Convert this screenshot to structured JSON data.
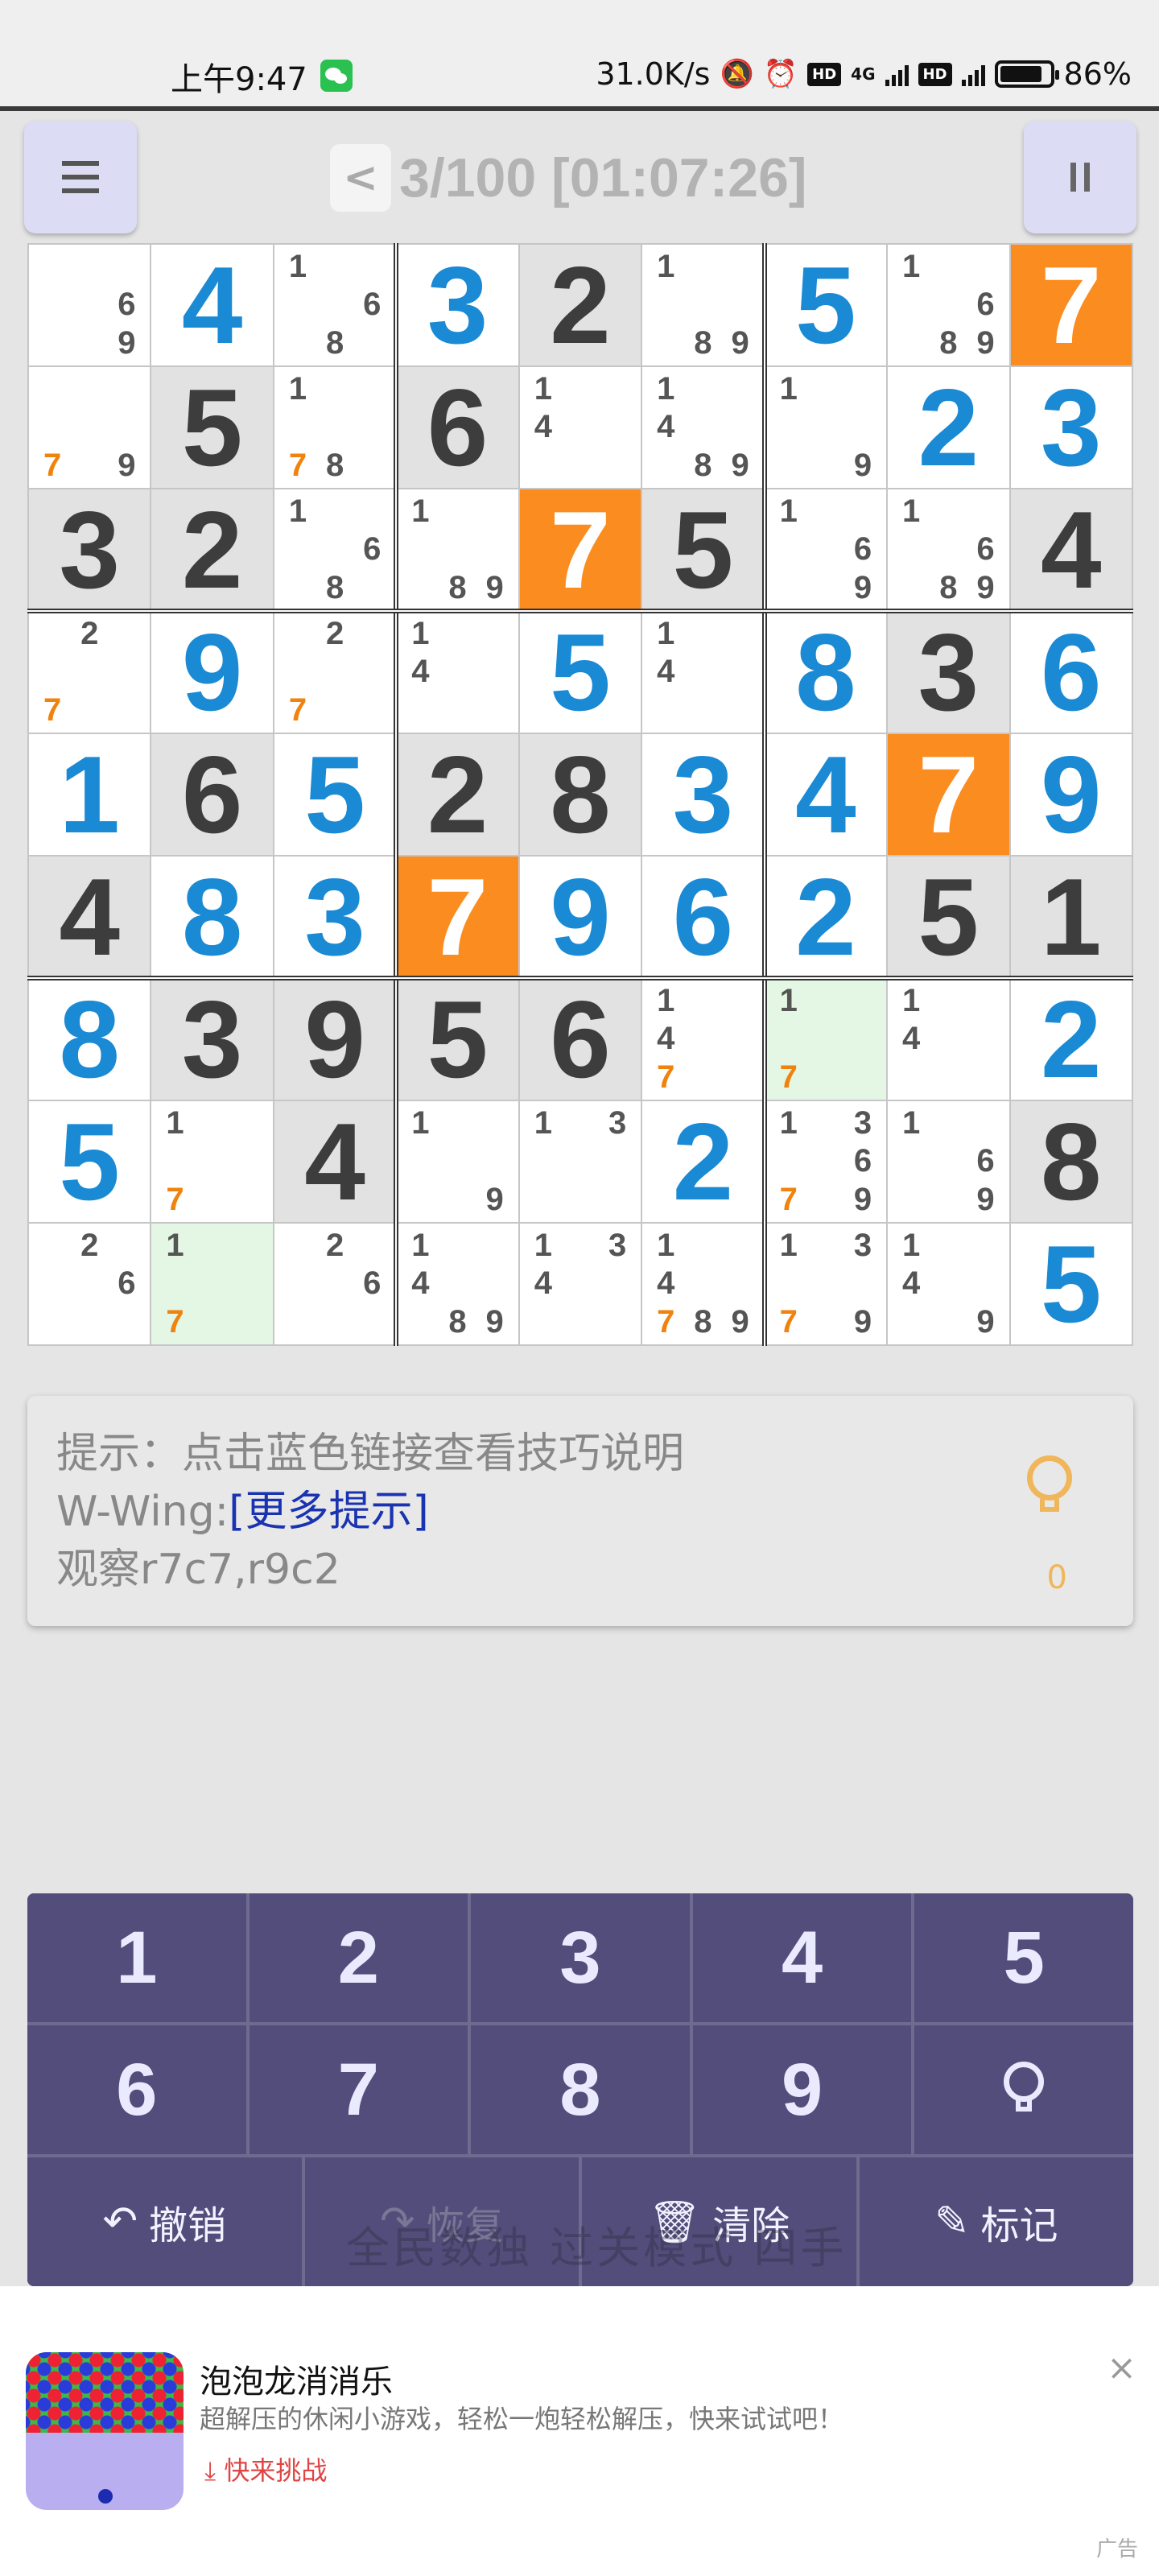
{
  "status_bar": {
    "time": "上午9:47",
    "net_speed": "31.0K/s",
    "battery": "86%",
    "battery_level": 0.86,
    "network": "4G",
    "hd_badge": "HD"
  },
  "header": {
    "back_label": "<",
    "title": "3/100 [01:07:26]"
  },
  "board": {
    "cells": [
      [
        {
          "c": [
            6,
            9
          ]
        },
        {
          "v": 4
        },
        {
          "c": [
            1,
            6,
            8
          ]
        },
        {
          "v": 3
        },
        {
          "v": 2,
          "g": true
        },
        {
          "c": [
            1,
            8,
            9
          ]
        },
        {
          "v": 5
        },
        {
          "c": [
            1,
            6,
            8,
            9
          ]
        },
        {
          "v": 7,
          "x": true
        }
      ],
      [
        {
          "c": [
            7,
            9
          ],
          "o": [
            7
          ]
        },
        {
          "v": 5,
          "g": true
        },
        {
          "c": [
            1,
            7,
            8
          ],
          "o": [
            7
          ]
        },
        {
          "v": 6,
          "g": true
        },
        {
          "c": [
            1,
            4
          ]
        },
        {
          "c": [
            1,
            4,
            8,
            9
          ]
        },
        {
          "c": [
            1,
            9
          ]
        },
        {
          "v": 2
        },
        {
          "v": 3
        }
      ],
      [
        {
          "v": 3,
          "g": true
        },
        {
          "v": 2,
          "g": true
        },
        {
          "c": [
            1,
            6,
            8
          ]
        },
        {
          "c": [
            1,
            8,
            9
          ]
        },
        {
          "v": 7,
          "x": true
        },
        {
          "v": 5,
          "g": true
        },
        {
          "c": [
            1,
            6,
            9
          ]
        },
        {
          "c": [
            1,
            6,
            8,
            9
          ]
        },
        {
          "v": 4,
          "g": true
        }
      ],
      [
        {
          "c": [
            2,
            7
          ],
          "o": [
            7
          ]
        },
        {
          "v": 9
        },
        {
          "c": [
            2,
            7
          ],
          "o": [
            7
          ]
        },
        {
          "c": [
            1,
            4
          ]
        },
        {
          "v": 5
        },
        {
          "c": [
            1,
            4
          ]
        },
        {
          "v": 8
        },
        {
          "v": 3,
          "g": true
        },
        {
          "v": 6
        }
      ],
      [
        {
          "v": 1
        },
        {
          "v": 6,
          "g": true
        },
        {
          "v": 5
        },
        {
          "v": 2,
          "g": true
        },
        {
          "v": 8,
          "g": true
        },
        {
          "v": 3
        },
        {
          "v": 4
        },
        {
          "v": 7,
          "x": true
        },
        {
          "v": 9
        }
      ],
      [
        {
          "v": 4,
          "g": true
        },
        {
          "v": 8
        },
        {
          "v": 3
        },
        {
          "v": 7,
          "x": true
        },
        {
          "v": 9
        },
        {
          "v": 6
        },
        {
          "v": 2
        },
        {
          "v": 5,
          "g": true
        },
        {
          "v": 1,
          "g": true
        }
      ],
      [
        {
          "v": 8
        },
        {
          "v": 3,
          "g": true
        },
        {
          "v": 9,
          "g": true
        },
        {
          "v": 5,
          "g": true
        },
        {
          "v": 6,
          "g": true
        },
        {
          "c": [
            1,
            4,
            7
          ],
          "o": [
            7
          ]
        },
        {
          "c": [
            1,
            7
          ],
          "o": [
            7
          ],
          "h": true
        },
        {
          "c": [
            1,
            4
          ]
        },
        {
          "v": 2
        }
      ],
      [
        {
          "v": 5
        },
        {
          "c": [
            1,
            7
          ],
          "o": [
            7
          ]
        },
        {
          "v": 4,
          "g": true
        },
        {
          "c": [
            1,
            9
          ]
        },
        {
          "c": [
            1,
            3
          ]
        },
        {
          "v": 2
        },
        {
          "c": [
            1,
            3,
            6,
            7,
            9
          ],
          "o": [
            7
          ]
        },
        {
          "c": [
            1,
            6,
            9
          ]
        },
        {
          "v": 8,
          "g": true
        }
      ],
      [
        {
          "c": [
            2,
            6
          ]
        },
        {
          "c": [
            1,
            7
          ],
          "o": [
            7
          ],
          "h": true
        },
        {
          "c": [
            2,
            6
          ]
        },
        {
          "c": [
            1,
            4,
            8,
            9
          ]
        },
        {
          "c": [
            1,
            3,
            4
          ]
        },
        {
          "c": [
            1,
            4,
            7,
            8,
            9
          ],
          "o": [
            7
          ]
        },
        {
          "c": [
            1,
            3,
            7,
            9
          ],
          "o": [
            7
          ]
        },
        {
          "c": [
            1,
            4,
            9
          ]
        },
        {
          "v": 5
        }
      ]
    ]
  },
  "hint": {
    "line1": "提示：点击蓝色链接查看技巧说明",
    "technique": "W-Wing:",
    "more_link": "[更多提示]",
    "line3": "观察r7c7,r9c2",
    "hint_count": "0"
  },
  "keypad": {
    "numbers": [
      "1",
      "2",
      "3",
      "4",
      "5",
      "6",
      "7",
      "8",
      "9"
    ],
    "undo": "撤销",
    "redo": "恢复",
    "clear": "清除",
    "mark": "标记"
  },
  "watermark": "全民数独 过关模式 四手",
  "ad": {
    "title": "泡泡龙消消乐",
    "description": "超解压的休闲小游戏，轻松一炮轻松解压，快来试试吧！",
    "cta": "快来挑战",
    "label": "广告",
    "close": "×"
  },
  "colors": {
    "given_bg": "#e2e2e2",
    "user_digit": "#1a8ad4",
    "conflict_bg": "#fb8c1f",
    "hint_bg": "#e4f6e4",
    "keypad_bg": "#524d7a"
  }
}
